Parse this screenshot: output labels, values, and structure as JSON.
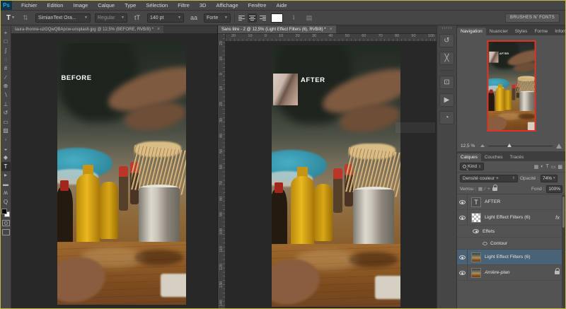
{
  "menu_bar": {
    "logo": "Ps",
    "items": [
      "Fichier",
      "Edition",
      "Image",
      "Calque",
      "Type",
      "Sélection",
      "Filtre",
      "3D",
      "Affichage",
      "Fenêtre",
      "Aide"
    ]
  },
  "options_bar": {
    "tool_glyph": "T",
    "font_family": "SimianText Ora...",
    "font_style": "Regular",
    "size_icon": "tT",
    "font_size": "140 pt",
    "anti_alias_icon": "aa",
    "anti_alias": "Forte",
    "workspace": "BRUSHES N' FONTS"
  },
  "toolbar": {
    "tools": [
      {
        "name": "move-tool",
        "glyph": "+"
      },
      {
        "name": "marquee-tool",
        "glyph": "□"
      },
      {
        "name": "lasso-tool",
        "glyph": "ʃ"
      },
      {
        "name": "quick-selection-tool",
        "glyph": "◌"
      },
      {
        "name": "crop-tool",
        "glyph": "#"
      },
      {
        "name": "eyedropper-tool",
        "glyph": "∕"
      },
      {
        "name": "healing-brush-tool",
        "glyph": "⊕"
      },
      {
        "name": "brush-tool",
        "glyph": "∖"
      },
      {
        "name": "clone-stamp-tool",
        "glyph": "⊥"
      },
      {
        "name": "history-brush-tool",
        "glyph": "↺"
      },
      {
        "name": "eraser-tool",
        "glyph": "▭"
      },
      {
        "name": "gradient-tool",
        "glyph": "▨"
      },
      {
        "name": "blur-tool",
        "glyph": "◦"
      },
      {
        "name": "dodge-tool",
        "glyph": "◒"
      },
      {
        "name": "pen-tool",
        "glyph": "◆"
      },
      {
        "name": "type-tool",
        "glyph": "T",
        "active": true
      },
      {
        "name": "path-selection-tool",
        "glyph": "▸"
      },
      {
        "name": "shape-tool",
        "glyph": "▬"
      },
      {
        "name": "hand-tool",
        "glyph": "ʍ"
      },
      {
        "name": "zoom-tool",
        "glyph": "Q"
      }
    ]
  },
  "documents": [
    {
      "tab": "laura-thonne-uzGQwQBApcw-unsplash.jpg @ 12,5% (BEFORE, RVB/8) *",
      "close": "×",
      "label": "BEFORE"
    },
    {
      "tab": "Sans titre - 2 @ 12,5% (Light Effect Filters (6), RVB/8) *",
      "close": "×",
      "label": "AFTER"
    }
  ],
  "rulers": {
    "horizontal": [
      "20",
      "10",
      "0",
      "10",
      "20",
      "30",
      "40",
      "50",
      "60",
      "70",
      "80",
      "90",
      "100"
    ],
    "vertical": [
      "20",
      "10",
      "0",
      "10",
      "20",
      "30",
      "40",
      "50",
      "60",
      "70",
      "80",
      "90",
      "100",
      "110",
      "120",
      "130",
      "140"
    ]
  },
  "dock": {
    "icons": [
      {
        "name": "history-panel-icon",
        "glyph": "↺"
      },
      {
        "name": "character-panel-icon",
        "glyph": "╳"
      },
      {
        "name": "clone-source-panel-icon",
        "glyph": "⊡"
      },
      {
        "name": "actions-panel-icon",
        "glyph": "▶"
      },
      {
        "name": "timeline-panel-icon",
        "glyph": "◔"
      }
    ]
  },
  "navigator": {
    "tabs": [
      "Navigation",
      "Nuancier",
      "Styles",
      "Forme",
      "Informat"
    ],
    "zoom_value": "12,5 %",
    "preview_label": "AFTER"
  },
  "layers_panel": {
    "tabs": [
      "Calques",
      "Couches",
      "Tracés"
    ],
    "filter_label": "Kind",
    "filter_icons": [
      {
        "name": "filter-pixel-layers-icon",
        "glyph": "▦"
      },
      {
        "name": "filter-adjustment-layers-icon",
        "glyph": "◐"
      },
      {
        "name": "filter-type-layers-icon",
        "glyph": "T"
      },
      {
        "name": "filter-shape-layers-icon",
        "glyph": "▭"
      },
      {
        "name": "filter-smart-objects-icon",
        "glyph": "▩"
      }
    ],
    "blend_mode": "Densité couleur +",
    "opacity_label": "Opacité :",
    "opacity_value": "74%",
    "lock_label": "Verrou :",
    "fill_label": "Fond :",
    "fill_value": "100%",
    "rows": {
      "text_layer": {
        "label": "AFTER",
        "thumb_glyph": "T"
      },
      "fx_layer": {
        "label": "Light Effect Filters (6)",
        "fx": "fx"
      },
      "effects": {
        "label": "Effets"
      },
      "contour": {
        "label": "Contour"
      },
      "selected_layer": {
        "label": "Light Effect Filters (6)"
      },
      "background_layer": {
        "label": "Arrière-plan"
      }
    }
  }
}
